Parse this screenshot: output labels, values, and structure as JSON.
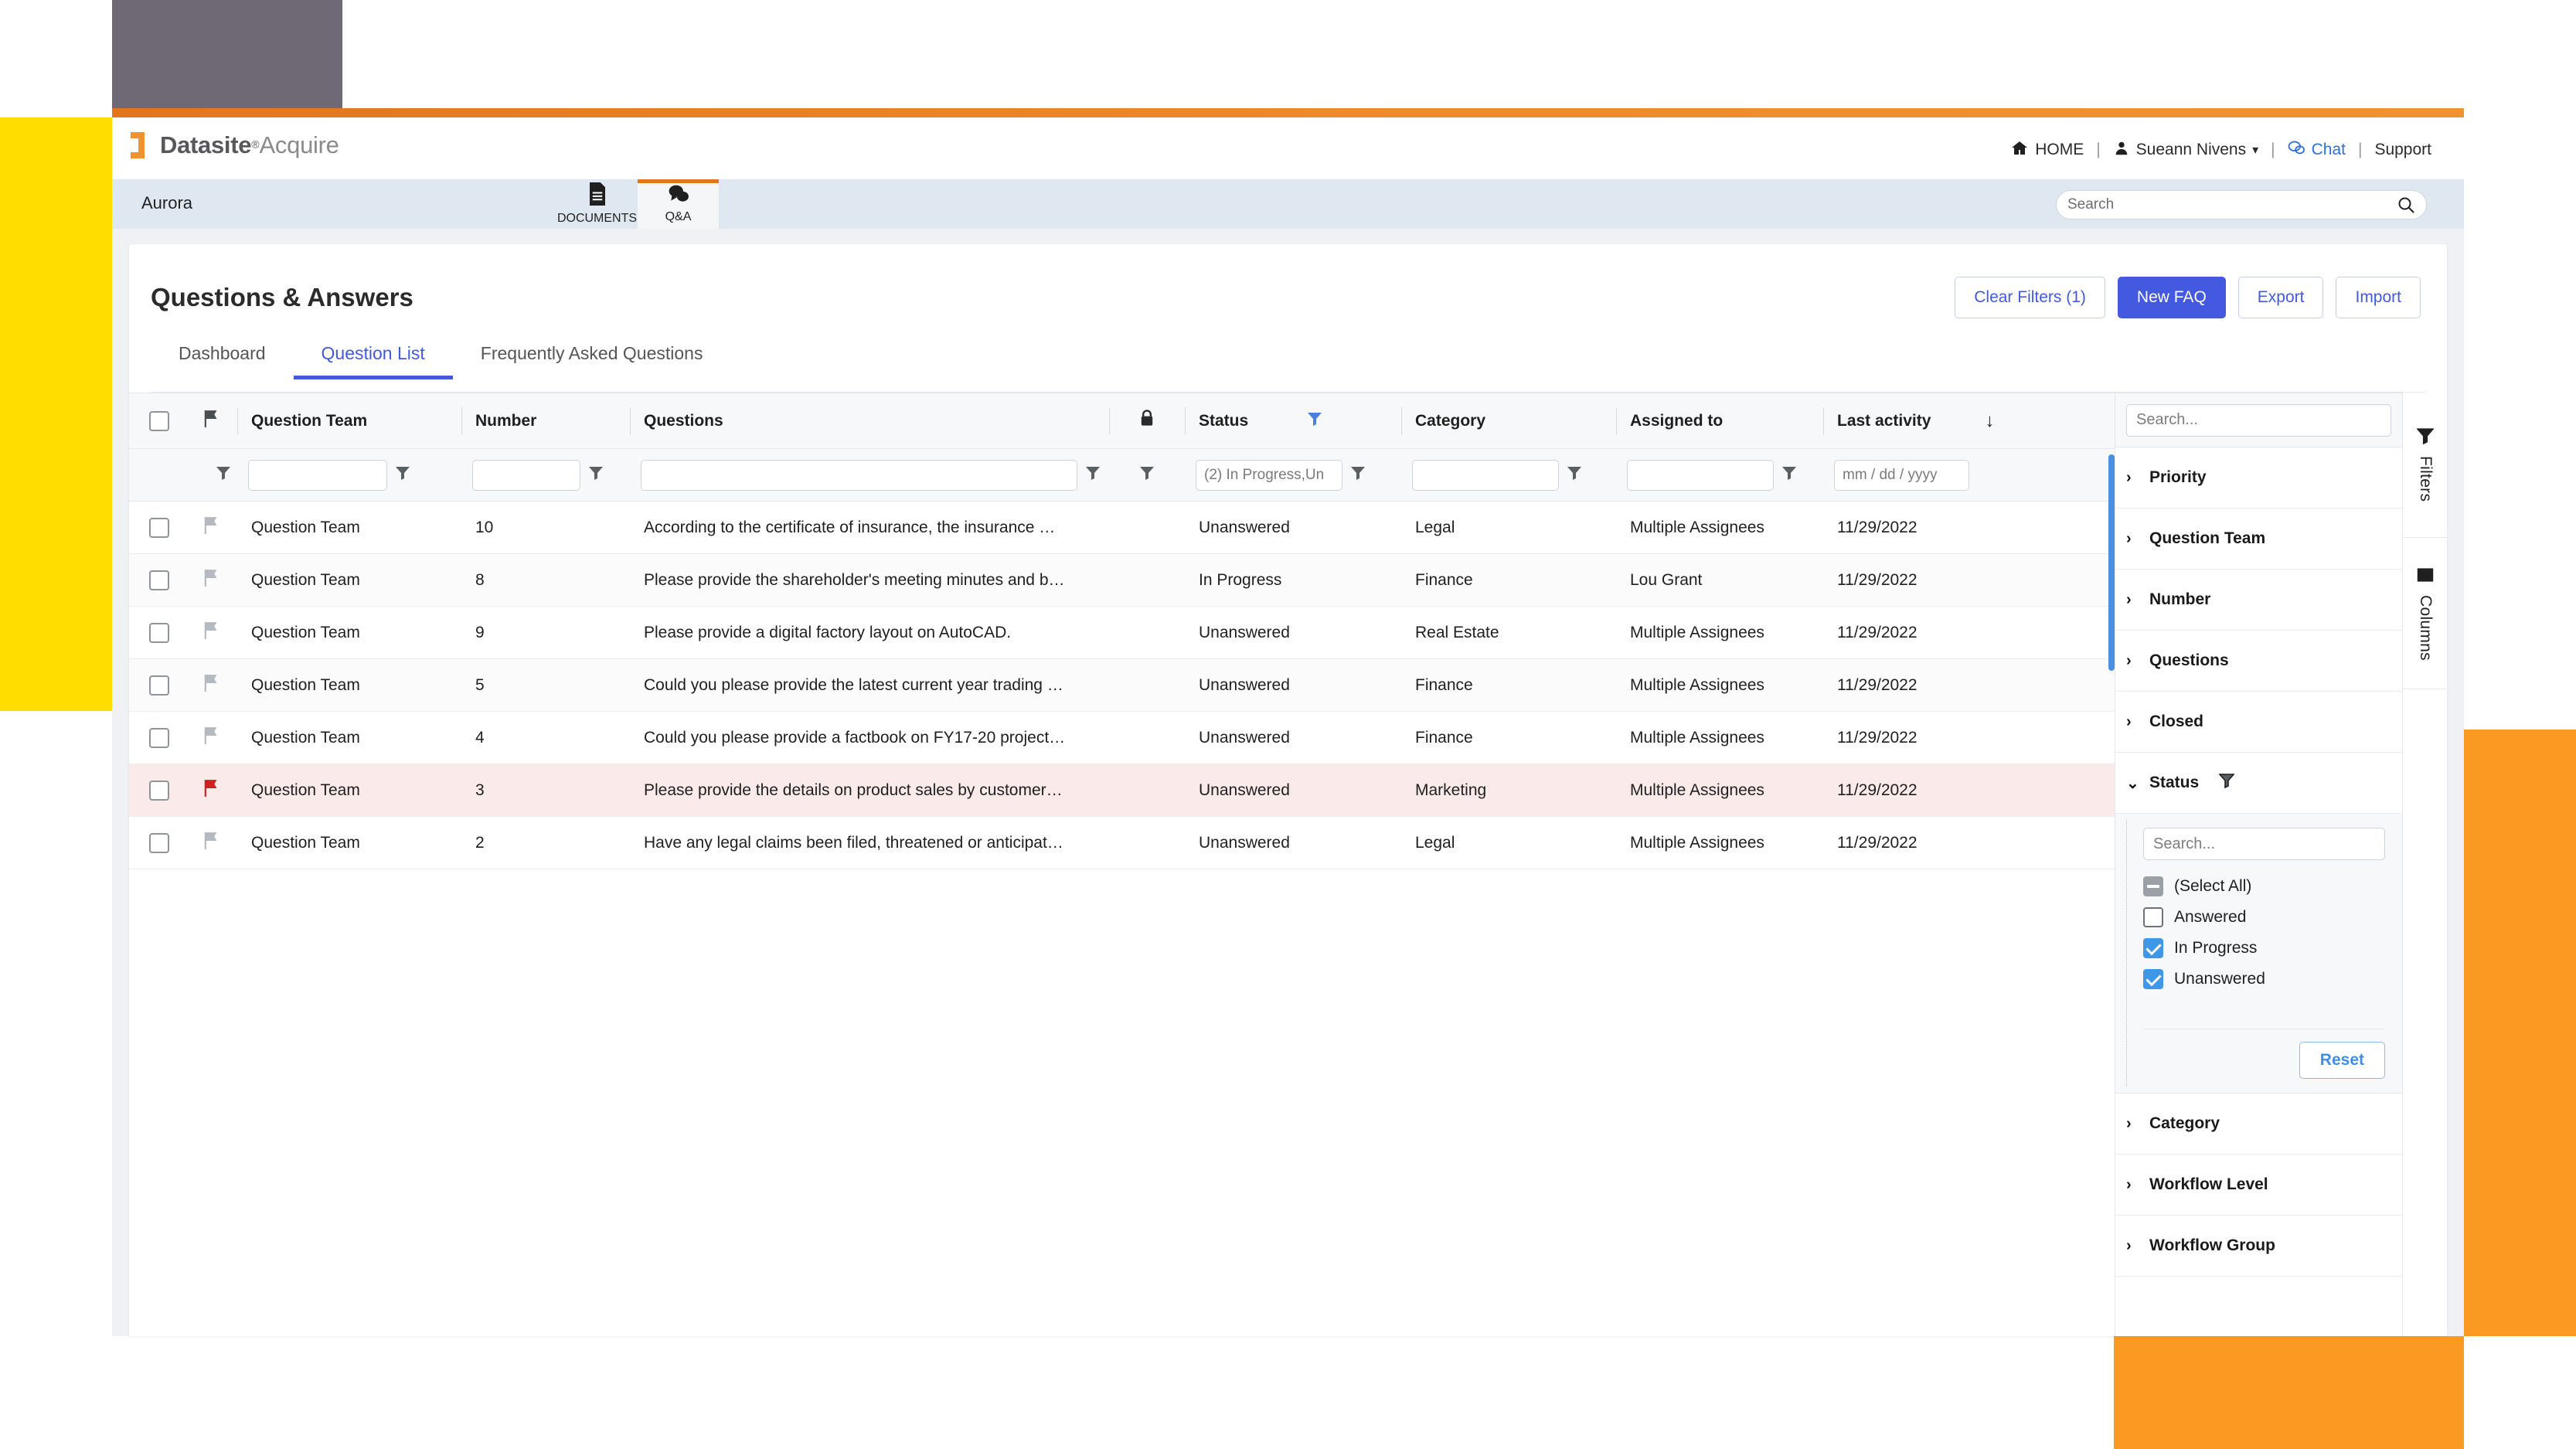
{
  "brand": {
    "name_bold": "Datasite",
    "registered_mark": "®",
    "name_regular": "Acquire"
  },
  "util_nav": {
    "home": "HOME",
    "user": "Sueann Nivens",
    "chat": "Chat",
    "support": "Support",
    "separator": "|",
    "caret": "▾"
  },
  "deal_bar": {
    "deal_name": "Aurora",
    "tabs": [
      {
        "label": "DOCUMENTS",
        "icon": "document-icon",
        "glyph": "🗎",
        "active": false
      },
      {
        "label": "Q&A",
        "icon": "chat-bubbles-icon",
        "glyph": "🗨",
        "active": true
      }
    ],
    "search_placeholder": "Search",
    "search_value": ""
  },
  "header": {
    "title": "Questions & Answers"
  },
  "actions": {
    "clear_filters": "Clear Filters (1)",
    "new_faq": "New FAQ",
    "export": "Export",
    "import": "Import"
  },
  "tabs": [
    {
      "label": "Dashboard",
      "active": false
    },
    {
      "label": "Question List",
      "active": true
    },
    {
      "label": "Frequently Asked Questions",
      "active": false
    }
  ],
  "grid": {
    "columns": [
      {
        "key": "check",
        "label": ""
      },
      {
        "key": "flag",
        "label": ""
      },
      {
        "key": "team",
        "label": "Question Team"
      },
      {
        "key": "number",
        "label": "Number"
      },
      {
        "key": "quest",
        "label": "Questions"
      },
      {
        "key": "lock",
        "label": ""
      },
      {
        "key": "status",
        "label": "Status"
      },
      {
        "key": "cat",
        "label": "Category"
      },
      {
        "key": "assign",
        "label": "Assigned to"
      },
      {
        "key": "last",
        "label": "Last activity"
      }
    ],
    "sort_indicator": "↓",
    "filter_row": {
      "team_value": "",
      "number_value": "",
      "questions_value": "",
      "status_value": "(2) In Progress,Un",
      "category_value": "",
      "assigned_value": "",
      "last_activity_placeholder": "mm / dd / yyyy"
    },
    "rows": [
      {
        "team": "Question Team",
        "number": "10",
        "question": "According to the certificate of insurance, the insurance …",
        "status": "Unanswered",
        "category": "Legal",
        "assigned": "Multiple Assignees",
        "last": "11/29/2022",
        "flagged": false
      },
      {
        "team": "Question Team",
        "number": "8",
        "question": "Please provide the shareholder's meeting minutes and b…",
        "status": "In Progress",
        "category": "Finance",
        "assigned": "Lou Grant",
        "last": "11/29/2022",
        "flagged": false
      },
      {
        "team": "Question Team",
        "number": "9",
        "question": "Please provide a digital factory layout on AutoCAD.",
        "status": "Unanswered",
        "category": "Real Estate",
        "assigned": "Multiple Assignees",
        "last": "11/29/2022",
        "flagged": false
      },
      {
        "team": "Question Team",
        "number": "5",
        "question": "Could you please provide the latest current year trading …",
        "status": "Unanswered",
        "category": "Finance",
        "assigned": "Multiple Assignees",
        "last": "11/29/2022",
        "flagged": false
      },
      {
        "team": "Question Team",
        "number": "4",
        "question": "Could you please provide a factbook on FY17-20 project…",
        "status": "Unanswered",
        "category": "Finance",
        "assigned": "Multiple Assignees",
        "last": "11/29/2022",
        "flagged": false
      },
      {
        "team": "Question Team",
        "number": "3",
        "question": "Please provide the details on product sales by customer…",
        "status": "Unanswered",
        "category": "Marketing",
        "assigned": "Multiple Assignees",
        "last": "11/29/2022",
        "flagged": true
      },
      {
        "team": "Question Team",
        "number": "2",
        "question": "Have any legal claims been filed, threatened or anticipat…",
        "status": "Unanswered",
        "category": "Legal",
        "assigned": "Multiple Assignees",
        "last": "11/29/2022",
        "flagged": false
      }
    ]
  },
  "right_panel": {
    "search_placeholder": "Search...",
    "search_value": "",
    "items": [
      {
        "label": "Priority",
        "expanded": false
      },
      {
        "label": "Question Team",
        "expanded": false
      },
      {
        "label": "Number",
        "expanded": false
      },
      {
        "label": "Questions",
        "expanded": false
      },
      {
        "label": "Closed",
        "expanded": false
      },
      {
        "label": "Status",
        "expanded": true
      },
      {
        "label": "Category",
        "expanded": false
      },
      {
        "label": "Workflow Level",
        "expanded": false
      },
      {
        "label": "Workflow Group",
        "expanded": false
      }
    ],
    "caret_collapsed": "›",
    "caret_expanded": "⌄",
    "status_filter": {
      "title": "Status",
      "search_placeholder": "Search...",
      "search_value": "",
      "options": [
        {
          "label": "(Select All)",
          "state": "indeterminate"
        },
        {
          "label": "Answered",
          "state": "unchecked"
        },
        {
          "label": "In Progress",
          "state": "checked"
        },
        {
          "label": "Unanswered",
          "state": "checked"
        }
      ],
      "reset_label": "Reset"
    }
  },
  "rail": {
    "filters": "Filters",
    "columns": "Columns"
  },
  "colors": {
    "accent_orange": "#e2761d",
    "primary_blue": "#4259e0",
    "checkbox_blue": "#3f97e8",
    "flag_red": "#cc2222",
    "deal_bar_bg": "#dfe8f1",
    "canvas_bg": "#eff1f5",
    "deco_yellow": "#ffdd00",
    "deco_orange": "#fb9a23",
    "deco_gray": "#6f6875"
  }
}
